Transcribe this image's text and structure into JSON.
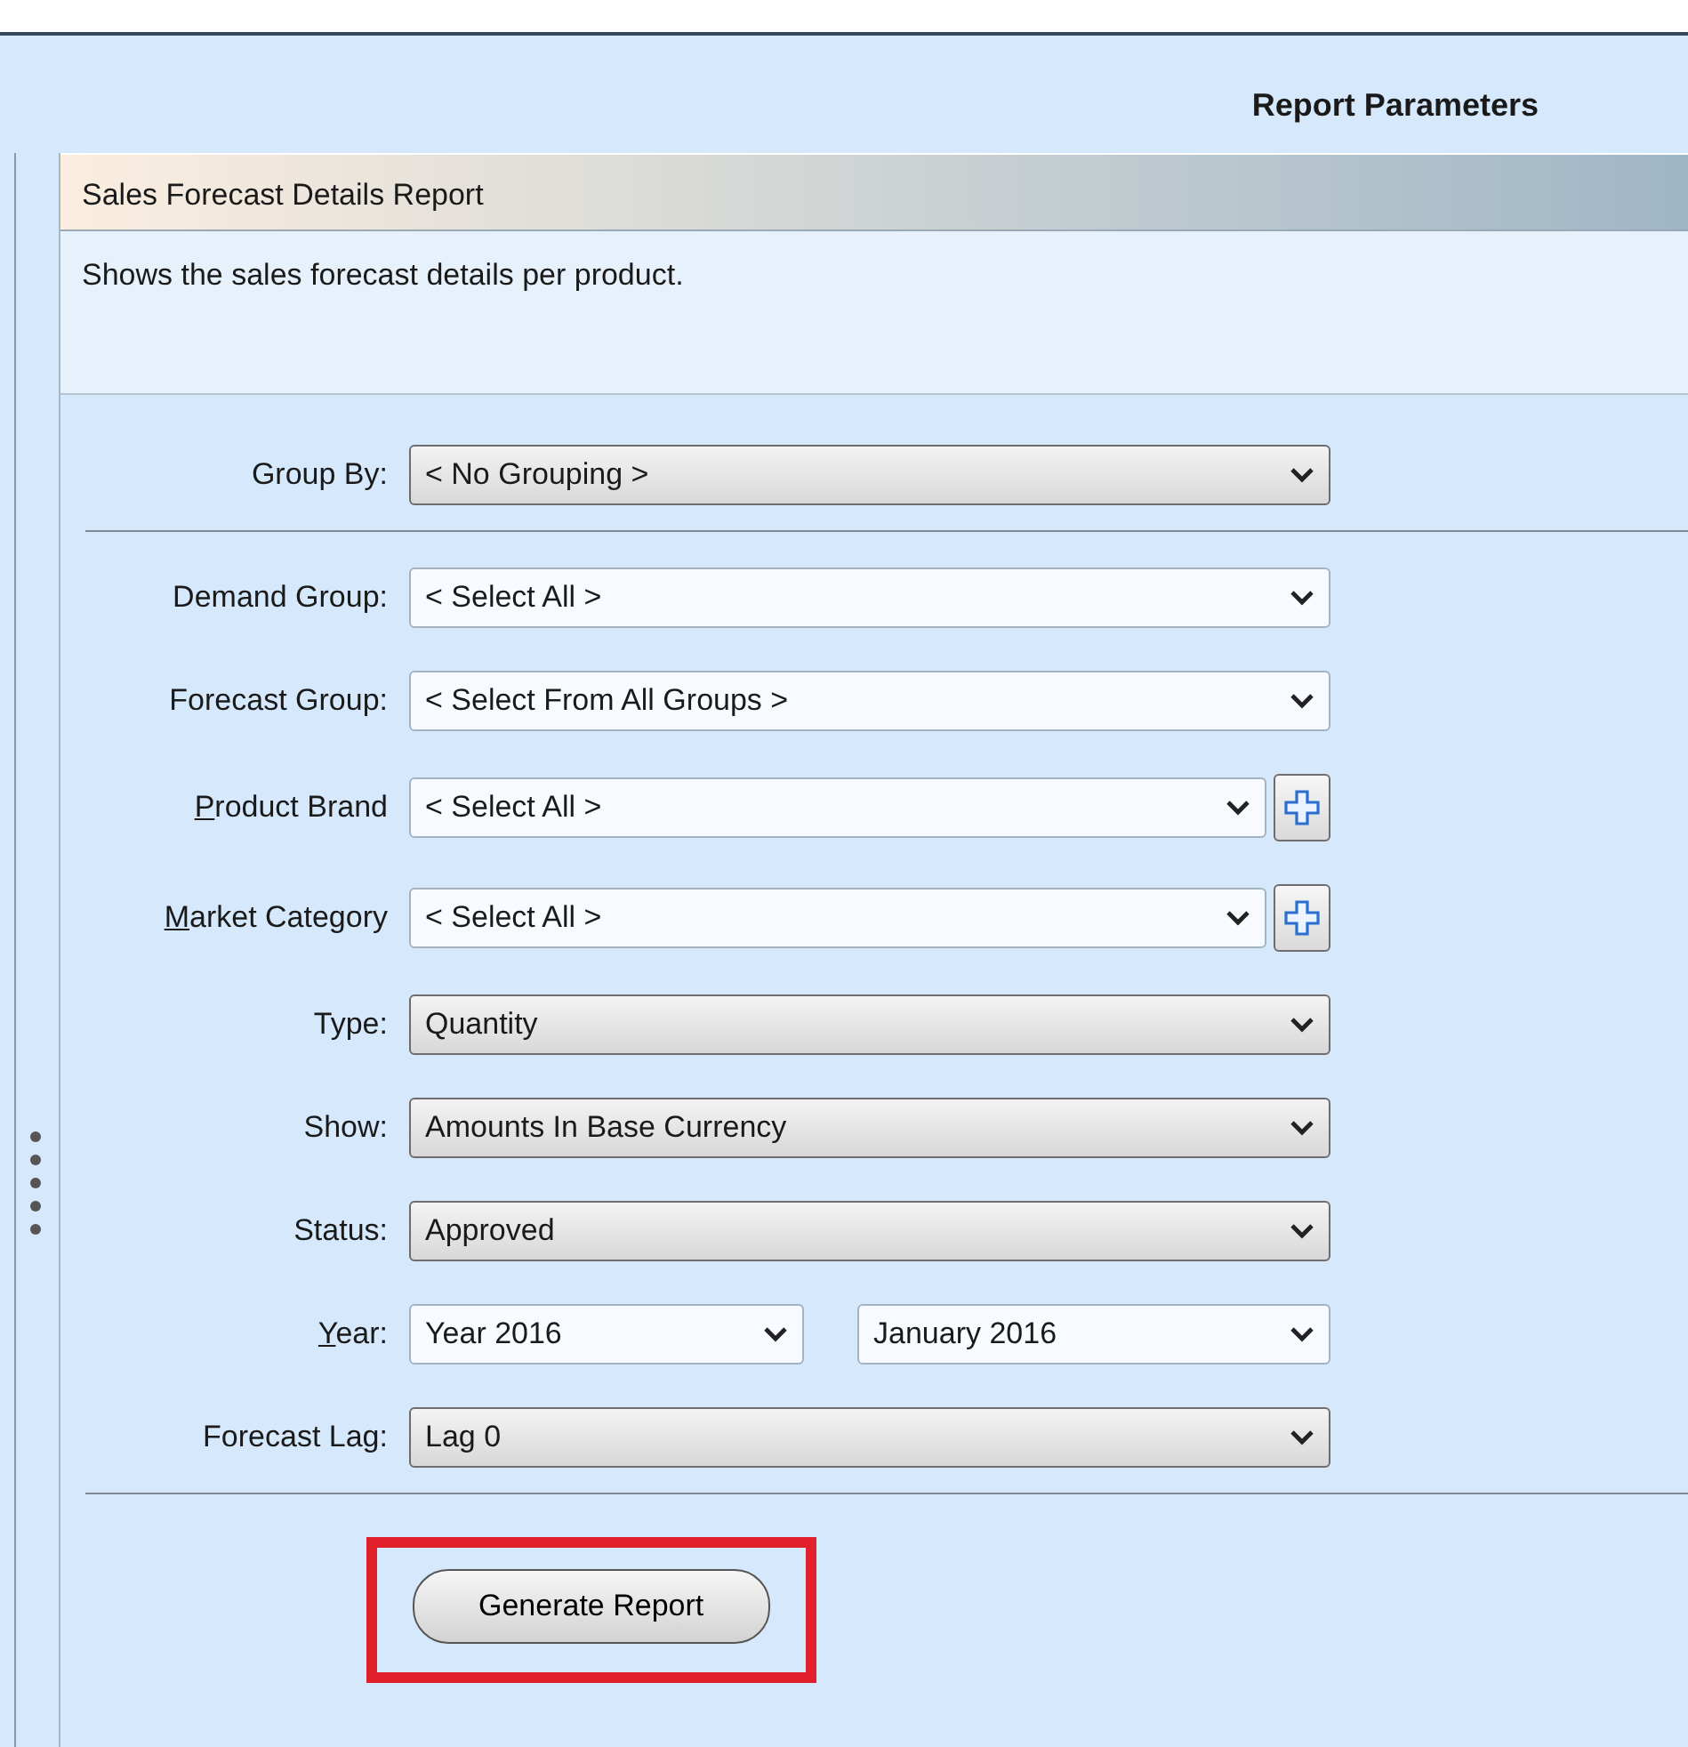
{
  "header": {
    "title": "Report Parameters"
  },
  "report": {
    "title": "Sales Forecast Details Report",
    "description": "Shows the sales forecast details per product."
  },
  "sections": [
    {
      "fields": [
        {
          "label": "Group By:",
          "mnemonic_first": false,
          "add_button": false,
          "controls": [
            {
              "value": "< No Grouping >",
              "kind": "combo"
            }
          ]
        }
      ]
    },
    {
      "fields": [
        {
          "label": "Demand Group:",
          "mnemonic_first": false,
          "add_button": false,
          "controls": [
            {
              "value": "< Select All >",
              "kind": "editable"
            }
          ]
        },
        {
          "label": "Forecast Group:",
          "mnemonic_first": false,
          "add_button": false,
          "controls": [
            {
              "value": "< Select From All Groups >",
              "kind": "editable"
            }
          ]
        },
        {
          "label": "Product Brand",
          "mnemonic_first": true,
          "add_button": true,
          "controls": [
            {
              "value": "< Select All >",
              "kind": "editable"
            }
          ]
        },
        {
          "label": "Market Category",
          "mnemonic_first": true,
          "add_button": true,
          "controls": [
            {
              "value": "< Select All >",
              "kind": "editable"
            }
          ]
        },
        {
          "label": "Type:",
          "mnemonic_first": false,
          "add_button": false,
          "controls": [
            {
              "value": "Quantity",
              "kind": "combo"
            }
          ]
        },
        {
          "label": "Show:",
          "mnemonic_first": false,
          "add_button": false,
          "controls": [
            {
              "value": "Amounts In Base Currency",
              "kind": "combo"
            }
          ]
        },
        {
          "label": "Status:",
          "mnemonic_first": false,
          "add_button": false,
          "controls": [
            {
              "value": "Approved",
              "kind": "combo"
            }
          ]
        },
        {
          "label": "Year:",
          "mnemonic_first": true,
          "add_button": false,
          "controls": [
            {
              "value": "Year 2016",
              "kind": "editable"
            },
            {
              "value": "January 2016",
              "kind": "editable"
            }
          ]
        },
        {
          "label": "Forecast Lag:",
          "mnemonic_first": false,
          "add_button": false,
          "controls": [
            {
              "value": "Lag 0",
              "kind": "combo"
            }
          ]
        }
      ]
    }
  ],
  "generate_button": {
    "label": "Generate Report",
    "highlighted": true
  }
}
